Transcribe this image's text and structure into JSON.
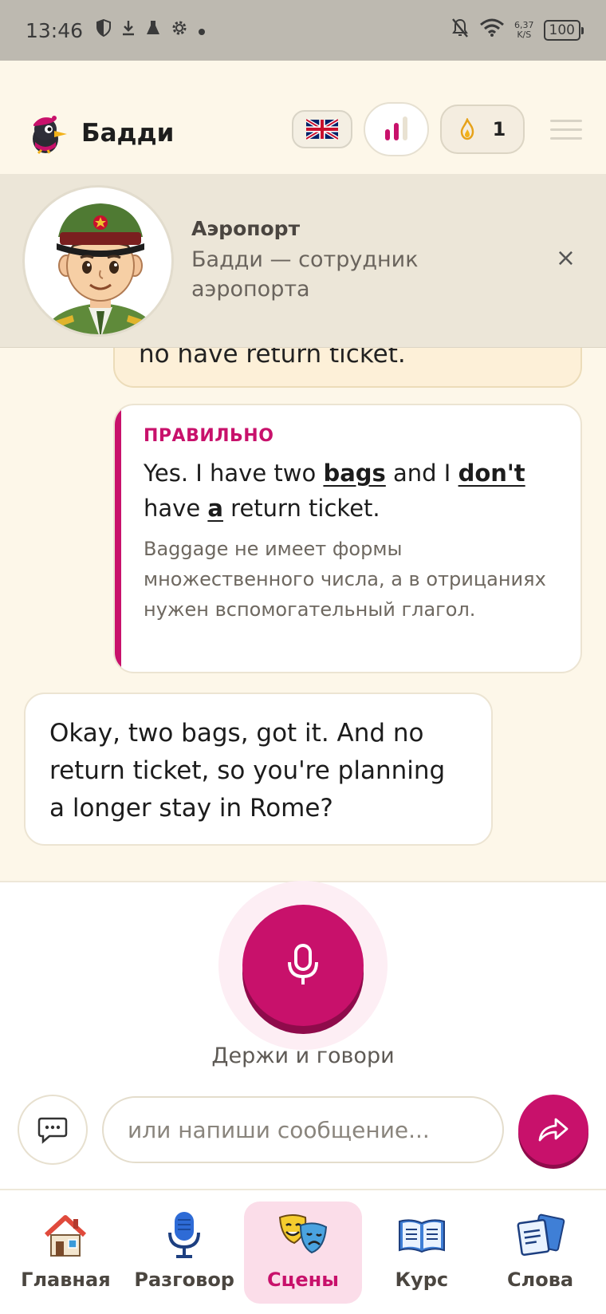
{
  "status_bar": {
    "time": "13:46",
    "net_speed_value": "6,37",
    "net_speed_unit": "K/S",
    "battery": "100"
  },
  "header": {
    "app_title": "Бадди",
    "streak_count": "1"
  },
  "scene": {
    "title": "Аэропорт",
    "subtitle": "Бадди — сотрудник аэропорта",
    "close_symbol": "×"
  },
  "chat": {
    "user_message_partial": "no have return ticket.",
    "correction": {
      "label": "ПРАВИЛЬНО",
      "parts": [
        "Yes. I have two ",
        "bags",
        " and I ",
        "don't",
        " have ",
        "a",
        " return ticket."
      ],
      "note": "Baggage не имеет формы множественного числа, а в отрицаниях нужен вспомогательный глагол."
    },
    "bot_message": "Okay, two bags, got it. And no return ticket, so you're planning a longer stay in Rome?"
  },
  "input": {
    "hold_label": "Держи и говори",
    "placeholder": "или напиши сообщение..."
  },
  "nav": {
    "items": [
      {
        "label": "Главная"
      },
      {
        "label": "Разговор"
      },
      {
        "label": "Сцены"
      },
      {
        "label": "Курс"
      },
      {
        "label": "Слова"
      }
    ]
  },
  "colors": {
    "accent": "#c8116b",
    "background": "#fdf7e9",
    "scene_banner": "#ece6d8"
  }
}
